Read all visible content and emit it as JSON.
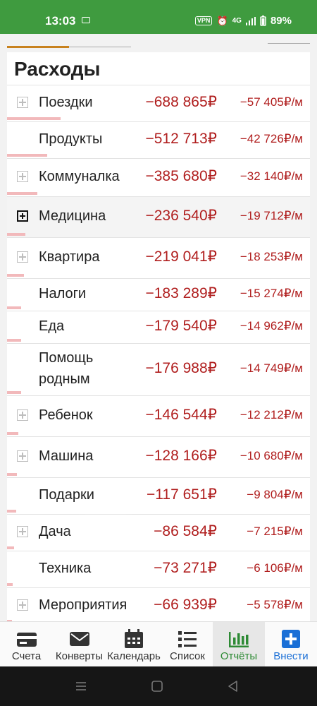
{
  "status_bar": {
    "time": "13:03",
    "vpn": "VPN",
    "network": "4G",
    "battery": "89%"
  },
  "page": {
    "title": "Расходы"
  },
  "rows": [
    {
      "label": "Поездки",
      "total": "−688 865₽",
      "monthly": "−57 405₽/м",
      "expandable": true,
      "bar_fraction": 1.0
    },
    {
      "label": "Продукты",
      "total": "−512 713₽",
      "monthly": "−42 726₽/м",
      "expandable": false,
      "bar_fraction": 0.744
    },
    {
      "label": "Коммуналка",
      "total": "−385 680₽",
      "monthly": "−32 140₽/м",
      "expandable": true,
      "bar_fraction": 0.56
    },
    {
      "label": "Медицина",
      "total": "−236 540₽",
      "monthly": "−19 712₽/м",
      "expandable": true,
      "bar_fraction": 0.343,
      "highlighted": true
    },
    {
      "label": "Квартира",
      "total": "−219 041₽",
      "monthly": "−18 253₽/м",
      "expandable": true,
      "bar_fraction": 0.318
    },
    {
      "label": "Налоги",
      "total": "−183 289₽",
      "monthly": "−15 274₽/м",
      "expandable": false,
      "bar_fraction": 0.266
    },
    {
      "label": "Еда",
      "total": "−179 540₽",
      "monthly": "−14 962₽/м",
      "expandable": false,
      "bar_fraction": 0.261
    },
    {
      "label": "Помощь родным",
      "total": "−176 988₽",
      "monthly": "−14 749₽/м",
      "expandable": false,
      "bar_fraction": 0.257
    },
    {
      "label": "Ребенок",
      "total": "−146 544₽",
      "monthly": "−12 212₽/м",
      "expandable": true,
      "bar_fraction": 0.213
    },
    {
      "label": "Машина",
      "total": "−128 166₽",
      "monthly": "−10 680₽/м",
      "expandable": true,
      "bar_fraction": 0.186
    },
    {
      "label": "Подарки",
      "total": "−117 651₽",
      "monthly": "−9 804₽/м",
      "expandable": false,
      "bar_fraction": 0.171
    },
    {
      "label": "Дача",
      "total": "−86 584₽",
      "monthly": "−7 215₽/м",
      "expandable": true,
      "bar_fraction": 0.126
    },
    {
      "label": "Техника",
      "total": "−73 271₽",
      "monthly": "−6 106₽/м",
      "expandable": false,
      "bar_fraction": 0.106
    },
    {
      "label": "Мероприятия",
      "total": "−66 939₽",
      "monthly": "−5 578₽/м",
      "expandable": true,
      "bar_fraction": 0.097
    }
  ],
  "bottom_nav": [
    {
      "label": "Счета",
      "icon": "wallet-icon"
    },
    {
      "label": "Конверты",
      "icon": "envelope-icon"
    },
    {
      "label": "Календарь",
      "icon": "calendar-icon"
    },
    {
      "label": "Список",
      "icon": "list-icon"
    },
    {
      "label": "Отчёты",
      "icon": "bar-chart-icon",
      "active": true
    },
    {
      "label": "Внести",
      "icon": "plus-icon"
    }
  ],
  "colors": {
    "status_bar": "#3f9b3f",
    "amount_red": "#b01e1e",
    "bar_pink": "#f2b9bb",
    "tab_accent": "#c8821e",
    "nav_active_green": "#2d8a34",
    "add_blue": "#1a6fd6"
  }
}
